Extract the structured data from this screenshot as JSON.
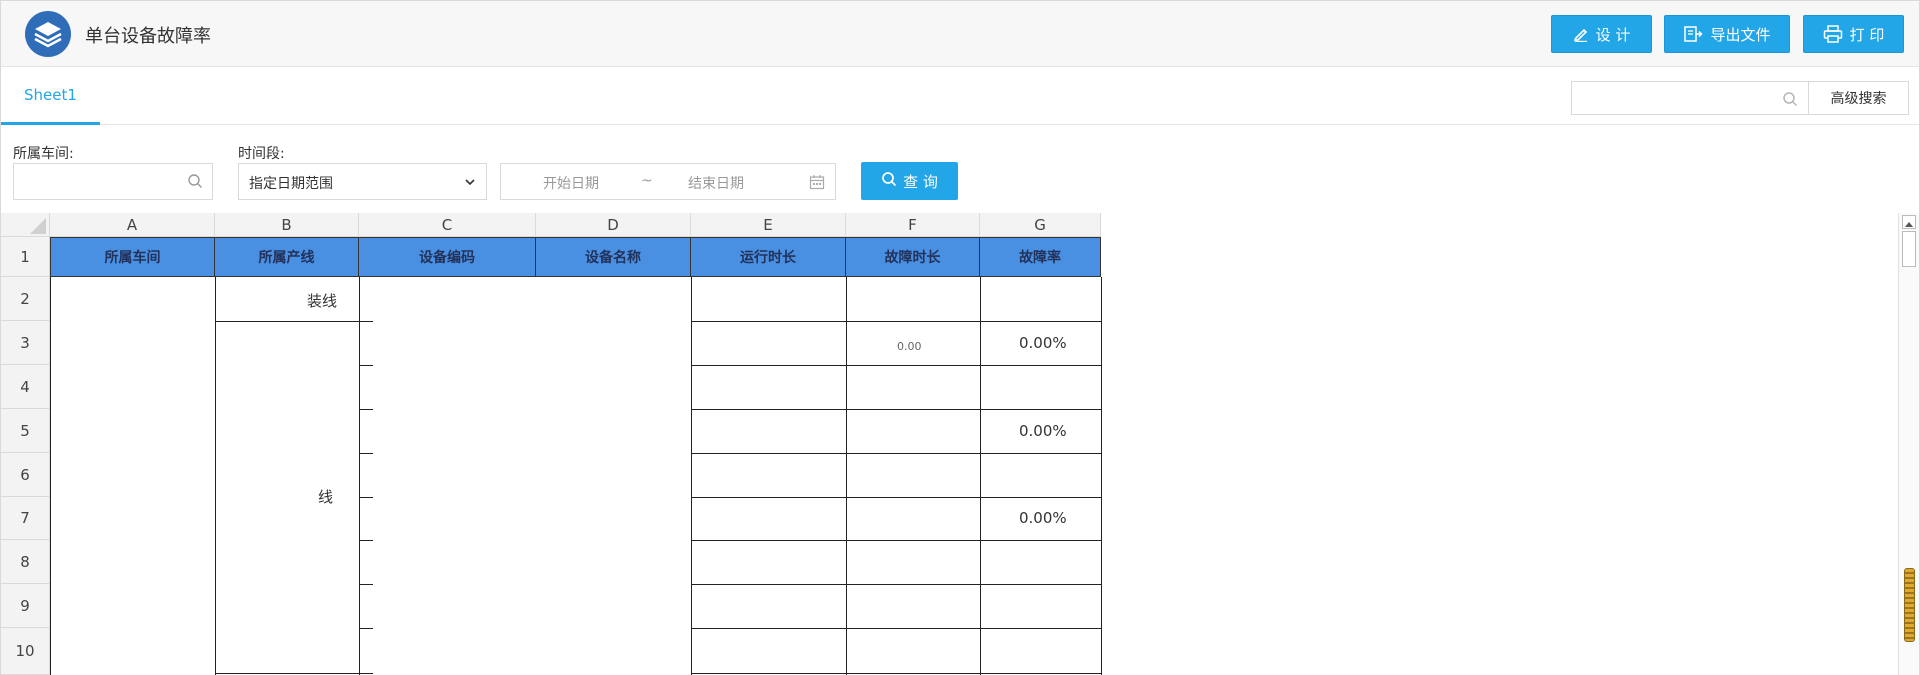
{
  "header": {
    "title": "单台设备故障率",
    "buttons": {
      "design": "设 计",
      "export": "导出文件",
      "print": "打 印"
    }
  },
  "tabs": [
    {
      "label": "Sheet1"
    }
  ],
  "search": {
    "placeholder": "",
    "advanced_label": "高级搜索"
  },
  "filters": {
    "workshop_label": "所属车间:",
    "workshop_value": "",
    "period_label": "时间段:",
    "period_value": "指定日期范围",
    "start_placeholder": "开始日期",
    "range_sep": "~",
    "end_placeholder": "结束日期",
    "query_label": "查 询"
  },
  "sheet": {
    "columns": [
      "A",
      "B",
      "C",
      "D",
      "E",
      "F",
      "G"
    ],
    "rows": [
      "1",
      "2",
      "3",
      "4",
      "5",
      "6",
      "7",
      "8",
      "9",
      "10"
    ],
    "headers": [
      "所属车间",
      "所属产线",
      "设备编码",
      "设备名称",
      "运行时长",
      "故障时长",
      "故障率"
    ],
    "cells": {
      "b2": "装线",
      "b_merged": "线",
      "f3": "0.00",
      "g3": "0.00%",
      "g5": "0.00%",
      "g7": "0.00%"
    }
  }
}
